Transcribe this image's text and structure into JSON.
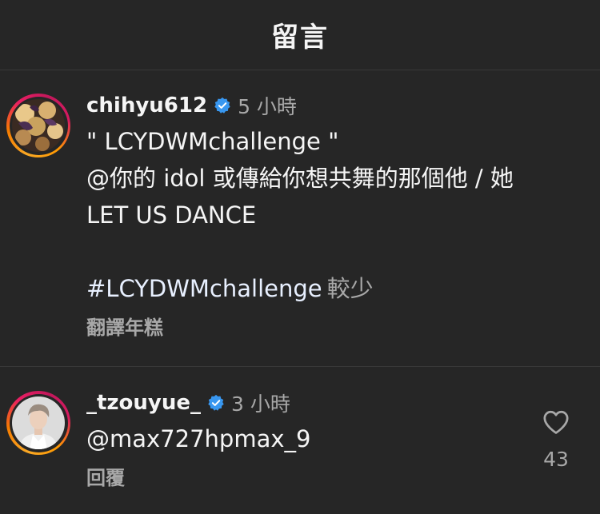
{
  "header": {
    "title": "留言"
  },
  "comments": [
    {
      "username": "chihyu612",
      "verified": true,
      "time": "5 小時",
      "lines": [
        "\" LCYDWMchallenge \"",
        "@你的 idol 或傳給你想共舞的那個他 / 她",
        "LET US DANCE"
      ],
      "hashtag": "#LCYDWMchallenge",
      "more_label": "較少",
      "action_label": "翻譯年糕"
    },
    {
      "username": "_tzouyue_",
      "verified": true,
      "time": "3 小時",
      "text": "@max727hpmax_9",
      "action_label": "回覆",
      "like_count": "43"
    }
  ],
  "colors": {
    "background": "#262626",
    "verified_badge": "#3897f0",
    "secondary_text": "#a8a8a8"
  },
  "icons": {
    "verified": "verified-badge-icon",
    "like": "heart-outline-icon"
  }
}
